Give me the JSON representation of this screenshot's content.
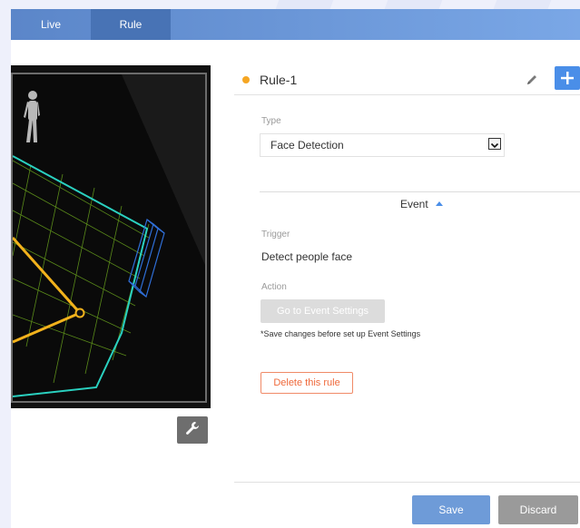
{
  "tabs": [
    {
      "label": "Live"
    },
    {
      "label": "Rule"
    }
  ],
  "rule": {
    "name": "Rule-1",
    "status_color": "#f5a623"
  },
  "type": {
    "label": "Type",
    "selected": "Face Detection"
  },
  "event": {
    "label": "Event",
    "trigger_label": "Trigger",
    "trigger_value": "Detect people face",
    "action_label": "Action",
    "goto_button": "Go to Event Settings",
    "note": "*Save changes before set up Event Settings"
  },
  "buttons": {
    "delete": "Delete this rule",
    "save": "Save",
    "discard": "Discard"
  },
  "icons": {
    "person": "person-icon",
    "wrench": "wrench-icon",
    "pencil": "pencil-icon",
    "plus": "plus-icon"
  },
  "colors": {
    "accent": "#4a8ee8",
    "topbar": "#5b86c9",
    "detection_area": "#2ad1c0",
    "line": "#f2b21c",
    "delete": "#ef6a3c"
  }
}
